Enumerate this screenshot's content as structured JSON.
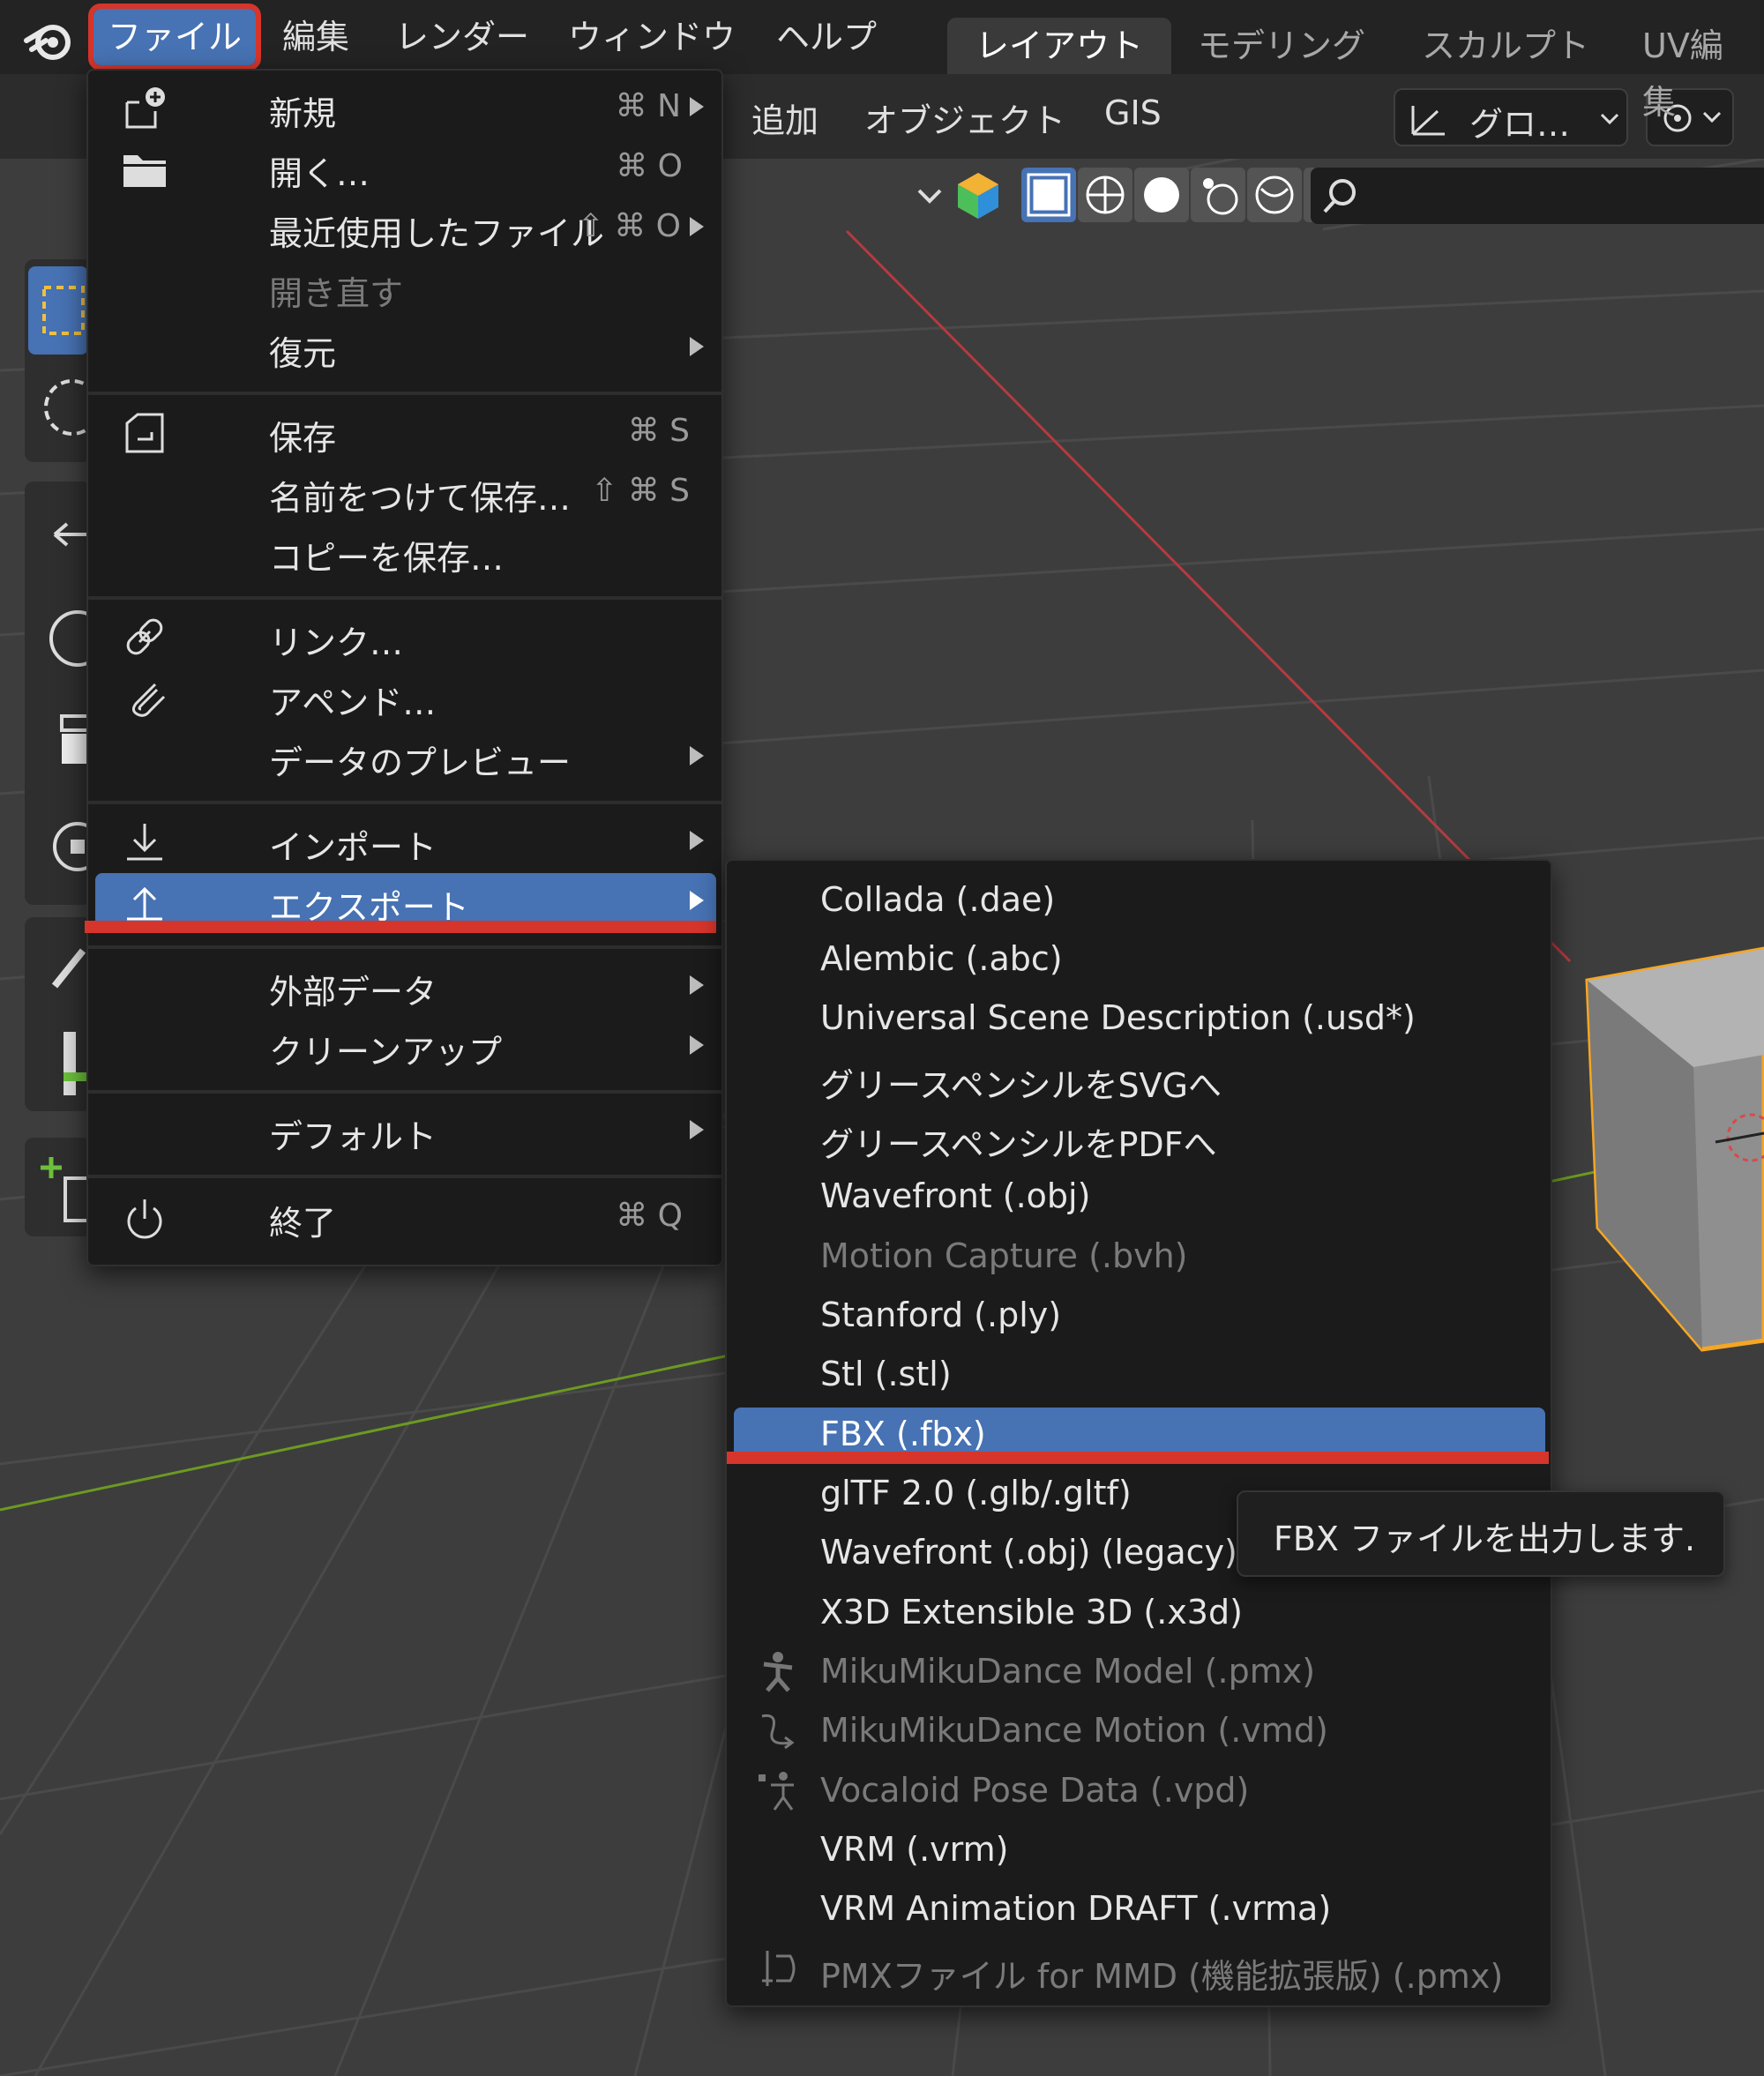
{
  "topbar": {
    "menus": [
      "ファイル",
      "編集",
      "レンダー",
      "ウィンドウ",
      "ヘルプ"
    ],
    "active_menu": "ファイル",
    "workspace_tabs": [
      "レイアウト",
      "モデリング",
      "スカルプト",
      "UV編集"
    ],
    "active_tab": "レイアウト"
  },
  "viewport_header": {
    "items": [
      "追加",
      "オブジェクト",
      "GIS"
    ],
    "orientation_dropdown": "グロ…"
  },
  "file_menu": {
    "items": [
      {
        "label": "新規",
        "shortcut": "⌘ N",
        "submenu": true,
        "icon": "new-file-icon"
      },
      {
        "label": "開く…",
        "shortcut": "⌘ O",
        "submenu": false,
        "icon": "folder-icon"
      },
      {
        "label": "最近使用したファイル",
        "shortcut": "⇧ ⌘ O",
        "submenu": true,
        "icon": ""
      },
      {
        "label": "開き直す",
        "shortcut": "",
        "submenu": false,
        "icon": "",
        "disabled": true
      },
      {
        "label": "復元",
        "shortcut": "",
        "submenu": true,
        "icon": ""
      },
      {
        "label": "保存",
        "shortcut": "⌘ S",
        "submenu": false,
        "icon": "save-icon"
      },
      {
        "label": "名前をつけて保存…",
        "shortcut": "⇧ ⌘ S",
        "submenu": false,
        "icon": ""
      },
      {
        "label": "コピーを保存…",
        "shortcut": "",
        "submenu": false,
        "icon": ""
      },
      {
        "label": "リンク…",
        "shortcut": "",
        "submenu": false,
        "icon": "link-icon"
      },
      {
        "label": "アペンド…",
        "shortcut": "",
        "submenu": false,
        "icon": "paperclip-icon"
      },
      {
        "label": "データのプレビュー",
        "shortcut": "",
        "submenu": true,
        "icon": ""
      },
      {
        "label": "インポート",
        "shortcut": "",
        "submenu": true,
        "icon": "import-icon"
      },
      {
        "label": "エクスポート",
        "shortcut": "",
        "submenu": true,
        "icon": "export-icon",
        "selected": true
      },
      {
        "label": "外部データ",
        "shortcut": "",
        "submenu": true,
        "icon": ""
      },
      {
        "label": "クリーンアップ",
        "shortcut": "",
        "submenu": true,
        "icon": ""
      },
      {
        "label": "デフォルト",
        "shortcut": "",
        "submenu": true,
        "icon": ""
      },
      {
        "label": "終了",
        "shortcut": "⌘ Q",
        "submenu": false,
        "icon": "power-icon"
      }
    ]
  },
  "export_menu": {
    "items": [
      {
        "label": "Collada (.dae)"
      },
      {
        "label": "Alembic (.abc)"
      },
      {
        "label": "Universal Scene Description (.usd*)"
      },
      {
        "label": "グリースペンシルをSVGへ"
      },
      {
        "label": "グリースペンシルをPDFへ"
      },
      {
        "label": "Wavefront (.obj)"
      },
      {
        "label": "Motion Capture (.bvh)",
        "disabled": true
      },
      {
        "label": "Stanford (.ply)"
      },
      {
        "label": "Stl (.stl)"
      },
      {
        "label": "FBX (.fbx)",
        "selected": true
      },
      {
        "label": "glTF 2.0 (.glb/.gltf)"
      },
      {
        "label": "Wavefront (.obj) (legacy)"
      },
      {
        "label": "X3D Extensible 3D (.x3d)"
      },
      {
        "label": "MikuMikuDance Model (.pmx)",
        "disabled": true,
        "icon": "mmd-model-icon"
      },
      {
        "label": "MikuMikuDance Motion (.vmd)",
        "disabled": true,
        "icon": "mmd-motion-icon"
      },
      {
        "label": "Vocaloid Pose Data (.vpd)",
        "disabled": true,
        "icon": "pose-icon"
      },
      {
        "label": "VRM (.vrm)"
      },
      {
        "label": "VRM Animation DRAFT (.vrma)"
      },
      {
        "label": "PMXファイル for MMD (機能拡張版) (.pmx)",
        "disabled": true,
        "icon": "pmx-icon"
      }
    ]
  },
  "tooltip": {
    "text": "FBX ファイルを出力します."
  },
  "colors": {
    "selection": "#4772b3",
    "highlight_red": "#d6352b",
    "menu_bg": "#1b1b1b",
    "cube_outline": "#f5a623"
  }
}
